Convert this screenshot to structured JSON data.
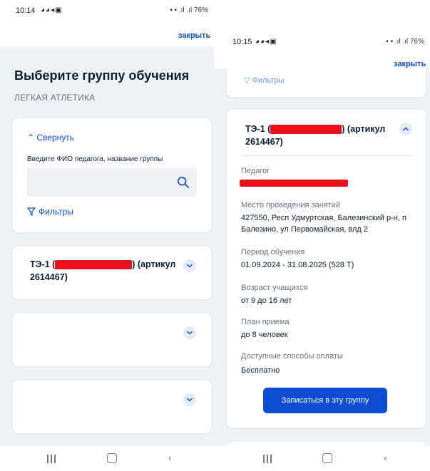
{
  "left": {
    "status": {
      "time": "10:14",
      "right": "76%"
    },
    "close_label": "закрыть",
    "title": "Выберите группу обучения",
    "subtitle": "ЛЕГКАЯ АТЛЕТИКА",
    "search": {
      "collapse_label": "Свернуть",
      "label": "Введите ФИО педагога, название группы",
      "value": ""
    },
    "filters_label": "Фильтры",
    "group": {
      "title_prefix": "ТЭ-1 (",
      "title_suffix": ") (артикул",
      "article": "2614467)"
    }
  },
  "right": {
    "status": {
      "time": "10:15",
      "right": "76%"
    },
    "close_label": "закрыть",
    "filters_label": "Фильтры",
    "group": {
      "title_prefix": "ТЭ-1 (",
      "title_suffix": ") (артикул",
      "article": "2614467)"
    },
    "fields": [
      {
        "label": "Педагог",
        "value": ""
      },
      {
        "label": "Место проведения занятий",
        "value": "427550, Респ Удмуртская, Балезинский р-н, п Балезино, ул Первомайская, влд 2"
      },
      {
        "label": "Период обучения",
        "value": "01.09.2024 - 31.08.2025 (528 Т)"
      },
      {
        "label": "Возраст учащихся",
        "value": "от 9 до 16 лет"
      },
      {
        "label": "План приема",
        "value": "до 8 человек"
      },
      {
        "label": "Доступные способы оплаты",
        "value": "Бесплатно"
      }
    ],
    "cta_label": "Записаться в эту группу"
  },
  "colors": {
    "accent": "#0d4cd3",
    "background": "#eef2f7",
    "redaction": "#e8111b"
  }
}
